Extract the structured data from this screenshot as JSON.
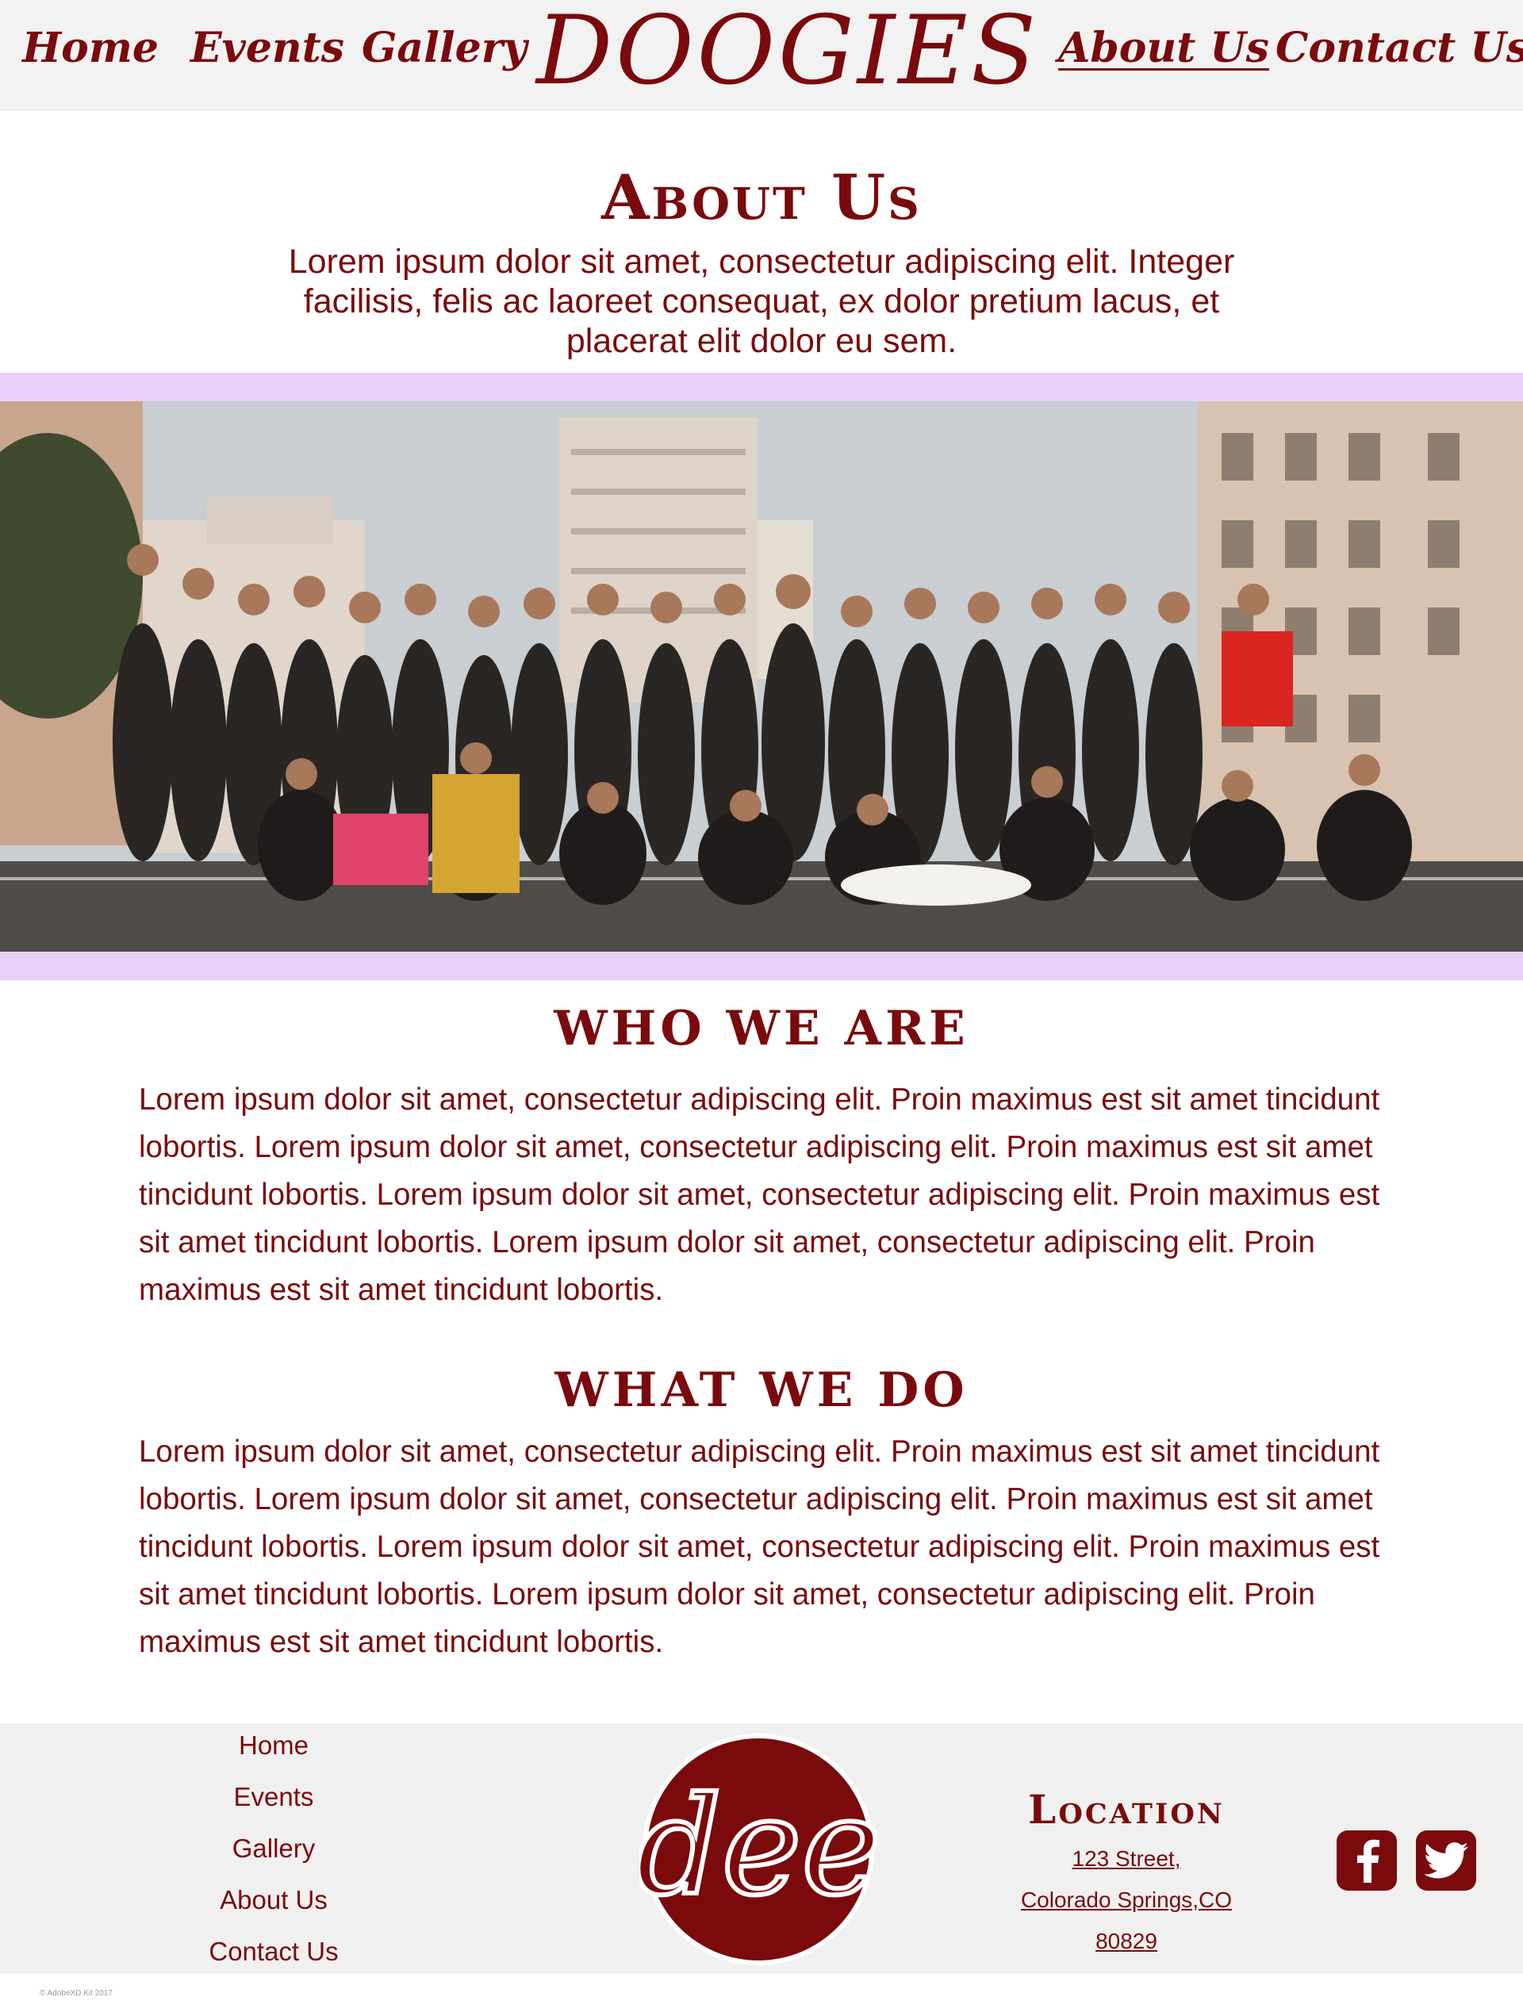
{
  "header": {
    "logo": "DOOGIES",
    "nav_left": [
      {
        "label": "Home"
      },
      {
        "label": "Events"
      },
      {
        "label": "Gallery"
      }
    ],
    "nav_right": [
      {
        "label": "About Us",
        "active": true
      },
      {
        "label": "Contact Us"
      }
    ]
  },
  "intro": {
    "title": "About Us",
    "text": "Lorem ipsum dolor sit amet, consectetur adipiscing elit. Integer facilisis, felis ac laoreet consequat, ex dolor pretium lacus, et placerat elit dolor eu sem."
  },
  "sections": [
    {
      "heading": "WHO WE ARE",
      "body": "Lorem ipsum dolor sit amet, consectetur adipiscing elit. Proin maximus est sit amet tincidunt lobortis. Lorem ipsum dolor sit amet, consectetur adipiscing elit. Proin maximus est sit amet tincidunt lobortis. Lorem ipsum dolor sit amet, consectetur adipiscing elit. Proin maximus est sit amet tincidunt lobortis. Lorem ipsum dolor sit amet, consectetur adipiscing elit. Proin maximus est sit amet tincidunt lobortis."
    },
    {
      "heading": "WHAT WE DO",
      "body": "Lorem ipsum dolor sit amet, consectetur adipiscing elit. Proin maximus est sit amet tincidunt lobortis. Lorem ipsum dolor sit amet, consectetur adipiscing elit. Proin maximus est sit amet tincidunt lobortis. Lorem ipsum dolor sit amet, consectetur adipiscing elit. Proin maximus est sit amet tincidunt lobortis. Lorem ipsum dolor sit amet, consectetur adipiscing elit. Proin maximus est sit amet tincidunt lobortis."
    }
  ],
  "footer": {
    "nav": [
      {
        "label": "Home"
      },
      {
        "label": "Events"
      },
      {
        "label": "Gallery"
      },
      {
        "label": "About Us"
      },
      {
        "label": "Contact Us"
      }
    ],
    "logo_monogram": "dee",
    "location": {
      "heading": "Location",
      "lines": [
        "123 Street,",
        "Colorado Springs,CO",
        "80829"
      ]
    },
    "social": [
      {
        "icon": "facebook-icon"
      },
      {
        "icon": "twitter-icon"
      }
    ],
    "copyright": "© AdobeXD Kit 2017"
  },
  "colors": {
    "brand": "#7a0a0c",
    "header_bg": "#f2f2f2",
    "band": "#e8d0fa",
    "footer_bg": "#f0f0f0"
  }
}
